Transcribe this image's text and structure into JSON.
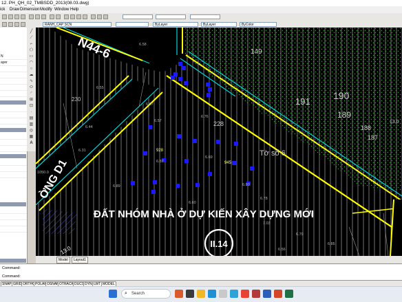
{
  "window": {
    "title": "12. PH_QH_02_TMBSDD_2013(08.03.dwg)"
  },
  "menu": [
    "ick",
    "Draw",
    "Dimension",
    "Modify",
    "Window",
    "Help"
  ],
  "toolbar": {
    "layer_name": "RANH_CAP SCN",
    "linetype": "ByLayer",
    "lineweight": "ByLayer",
    "color": "ByColor"
  },
  "left_panel": {
    "rows": [
      "N",
      "ayer"
    ]
  },
  "drawing": {
    "road_label_top": "N44-6",
    "road_label_left": "ỜNG D1",
    "main_caption": "ĐẤT NHÓM NHÀ Ở DỰ KIẾN XÂY DỰNG MỚI",
    "zone_code": "II.14",
    "parcel_label": "Tờ số 6",
    "parcel_numbers": [
      "149",
      "190",
      "191",
      "189",
      "188",
      "187",
      "228",
      "928",
      "945",
      "230",
      "13.0"
    ],
    "elevations": [
      "6.58",
      "6.55",
      "6.57",
      "6.76",
      "6.67",
      "6.44",
      "6.31",
      "6.87",
      "6.69",
      "6.80",
      "6.89",
      "6.60",
      "6.78",
      "7.03",
      "6.79",
      "6.56",
      "6.78",
      "6.85",
      "1050.0",
      "13.0"
    ]
  },
  "tabs": [
    "Model",
    "Layout1"
  ],
  "command": {
    "line1": "Command:",
    "line2": "Command:"
  },
  "status_buttons": [
    "SNAP",
    "GRID",
    "ORTHO",
    "POLAR",
    "OSNAP",
    "OTRACK",
    "DUCS",
    "DYN",
    "LWT",
    "MODEL"
  ],
  "taskbar": {
    "search_placeholder": "Search"
  },
  "colors": {
    "canvas_bg": "#000000",
    "boundary_yellow": "#ffff00",
    "road_cyan": "#00d8d8",
    "marker_blue": "#1a1aff",
    "hatch_green": "#2f8a2f"
  }
}
